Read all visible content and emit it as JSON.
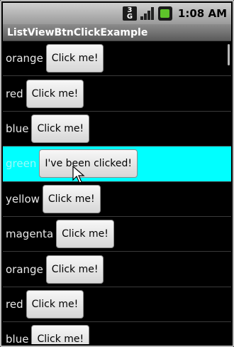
{
  "status_bar": {
    "network_top": "3",
    "network_bottom": "G",
    "time": "1:08 AM",
    "battery_color": "#5ec32a"
  },
  "app": {
    "title": "ListViewBtnClickExample"
  },
  "list": {
    "items": [
      {
        "label": "orange",
        "button": "Click me!"
      },
      {
        "label": "red",
        "button": "Click me!"
      },
      {
        "label": "blue",
        "button": "Click me!"
      },
      {
        "label": "green",
        "button": "I've been clicked!",
        "selected": true
      },
      {
        "label": "yellow",
        "button": "Click me!"
      },
      {
        "label": "magenta",
        "button": "Click me!"
      },
      {
        "label": "orange",
        "button": "Click me!"
      },
      {
        "label": "red",
        "button": "Click me!"
      },
      {
        "label": "blue",
        "button": "Click me!"
      }
    ],
    "highlight_color": "#00ffff"
  },
  "icons": [
    "3g-icon",
    "signal-icon",
    "battery-icon",
    "mouse-cursor-icon"
  ]
}
